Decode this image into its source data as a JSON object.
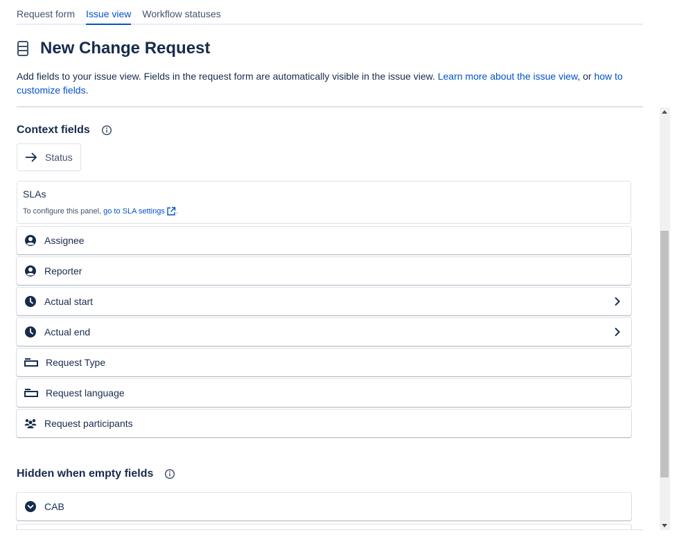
{
  "tabs": [
    {
      "label": "Request form",
      "active": false
    },
    {
      "label": "Issue view",
      "active": true
    },
    {
      "label": "Workflow statuses",
      "active": false
    }
  ],
  "page": {
    "title": "New Change Request",
    "title_icon": "form-icon",
    "description_prefix": "Add fields to your issue view. Fields in the request form are automatically visible in the issue view. ",
    "link_learn_more": "Learn more about the issue view",
    "description_mid": ", or ",
    "link_customize": "how to customize fields",
    "description_suffix": "."
  },
  "context_fields": {
    "heading": "Context fields",
    "status_chip": {
      "label": "Status",
      "icon": "arrow-right-icon"
    },
    "sla": {
      "title": "SLAs",
      "note_prefix": "To configure this panel,",
      "link": "go to SLA settings",
      "note_suffix": "."
    },
    "items": [
      {
        "label": "Assignee",
        "icon": "user-avatar-icon",
        "chevron": false
      },
      {
        "label": "Reporter",
        "icon": "user-avatar-icon",
        "chevron": false
      },
      {
        "label": "Actual start",
        "icon": "clock-icon",
        "chevron": true
      },
      {
        "label": "Actual end",
        "icon": "clock-icon",
        "chevron": true
      },
      {
        "label": "Request Type",
        "icon": "short-text-icon",
        "chevron": false
      },
      {
        "label": "Request language",
        "icon": "short-text-icon",
        "chevron": false
      },
      {
        "label": "Request participants",
        "icon": "people-group-icon",
        "chevron": false
      }
    ]
  },
  "hidden_fields": {
    "heading": "Hidden when empty fields",
    "items": [
      {
        "label": "CAB",
        "icon": "dropdown-select-icon"
      }
    ]
  },
  "colors": {
    "link": "#0052cc",
    "text": "#172b4d",
    "subtle_text": "#42526e",
    "border": "#dfe1e6"
  }
}
